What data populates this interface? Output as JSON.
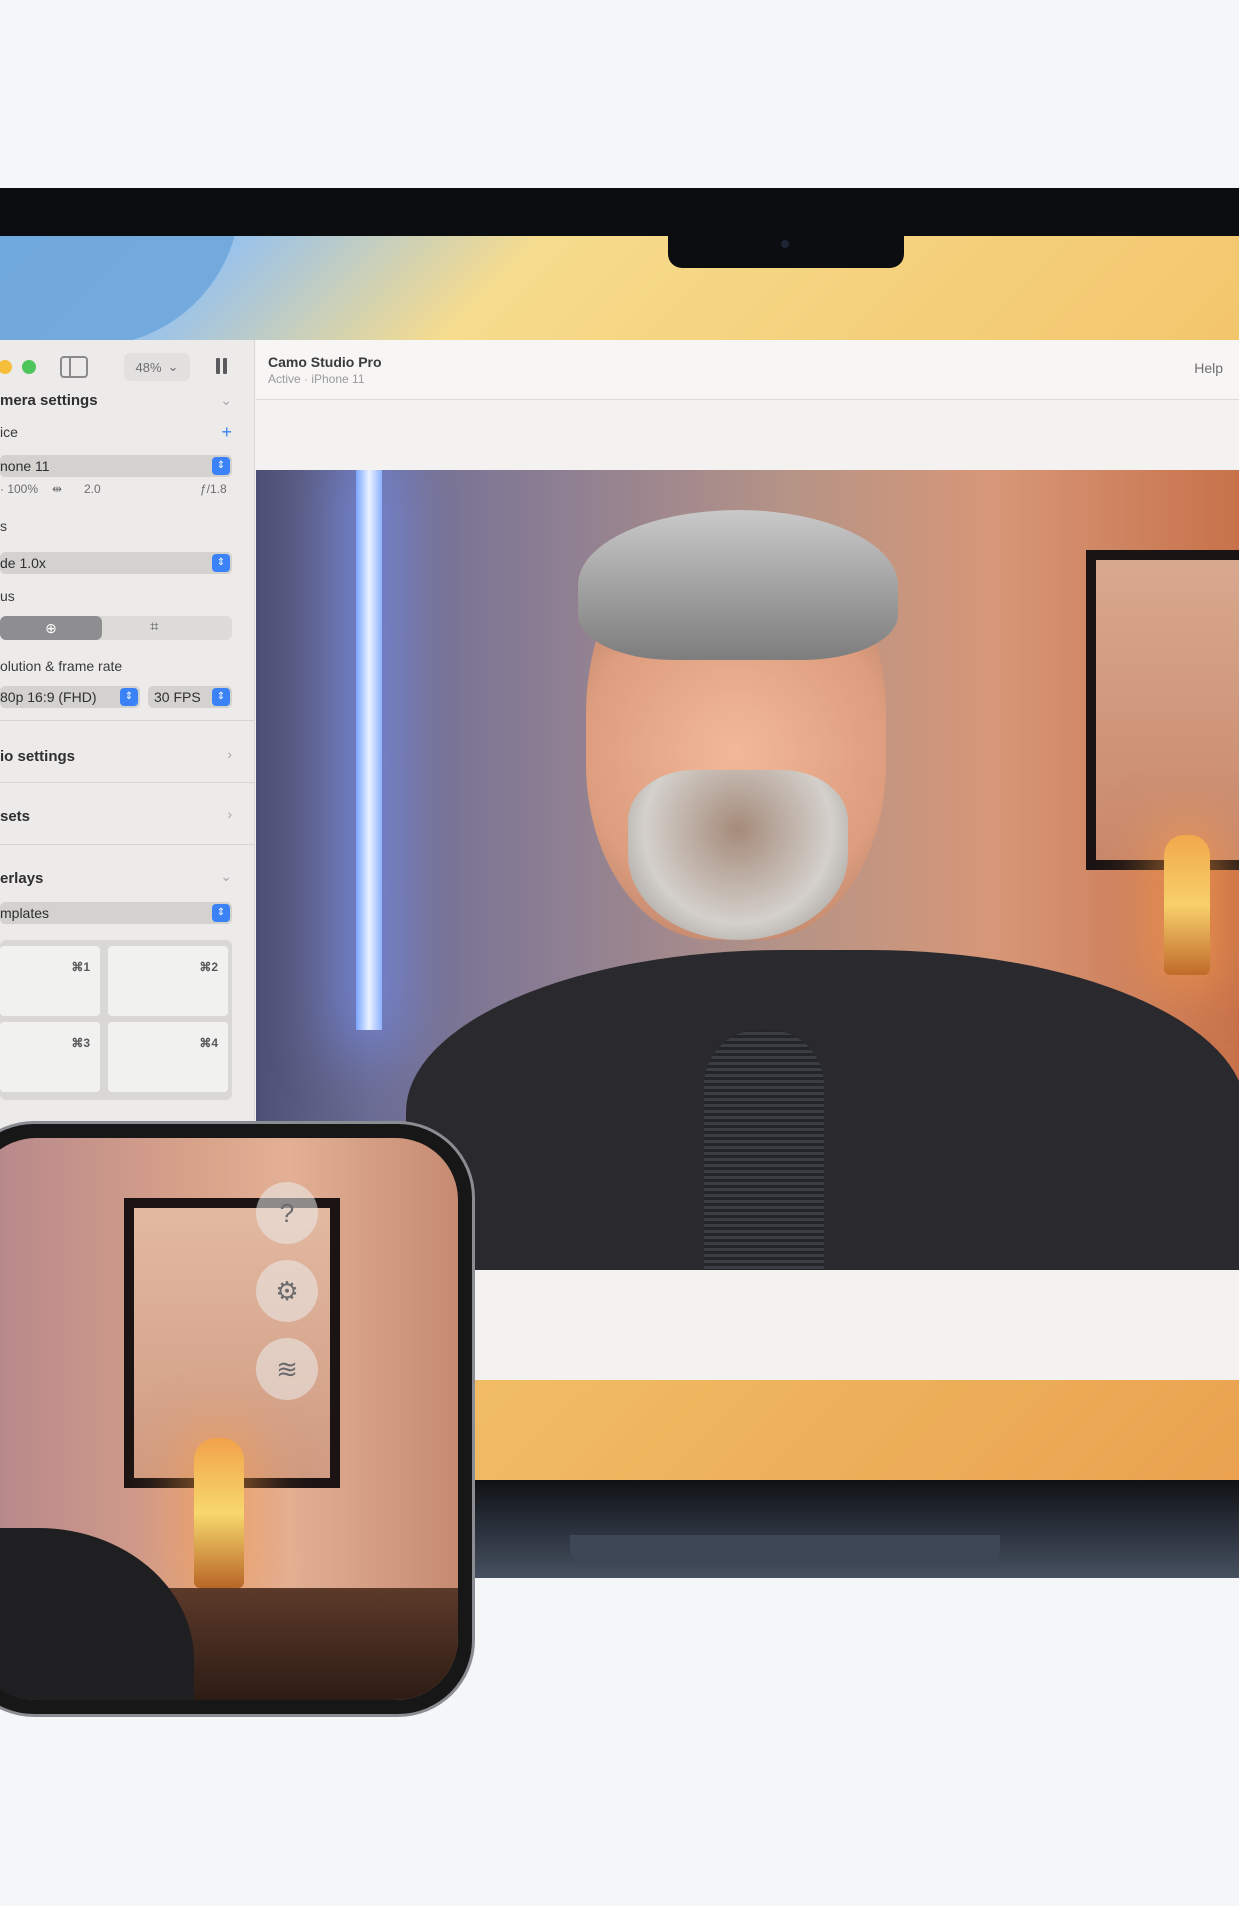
{
  "app": {
    "title": "Camo Studio Pro",
    "subtitle": "Active · iPhone 11",
    "help_label": "Help",
    "zoom": "48%"
  },
  "sidebar": {
    "camera_settings": "mera settings",
    "device_label": "ice",
    "device_value": "none 11",
    "meta": {
      "battery": "· 100%",
      "usb": "2.0",
      "aperture": "ƒ/1.8"
    },
    "lens_label": "s",
    "lens_value": "de 1.0x",
    "focus_label": "us",
    "resolution_label": "olution & frame rate",
    "resolution_value": "80p 16:9 (FHD)",
    "fps_value": "30 FPS",
    "audio_settings": "io settings",
    "presets": "sets",
    "overlays": "erlays",
    "templates_value": "mplates",
    "overlay_shortcuts": [
      "⌘1",
      "⌘2",
      "⌘3",
      "⌘4"
    ]
  },
  "phone": {
    "help_glyph": "?",
    "settings_glyph": "⚙",
    "wifi_glyph": "≋"
  }
}
